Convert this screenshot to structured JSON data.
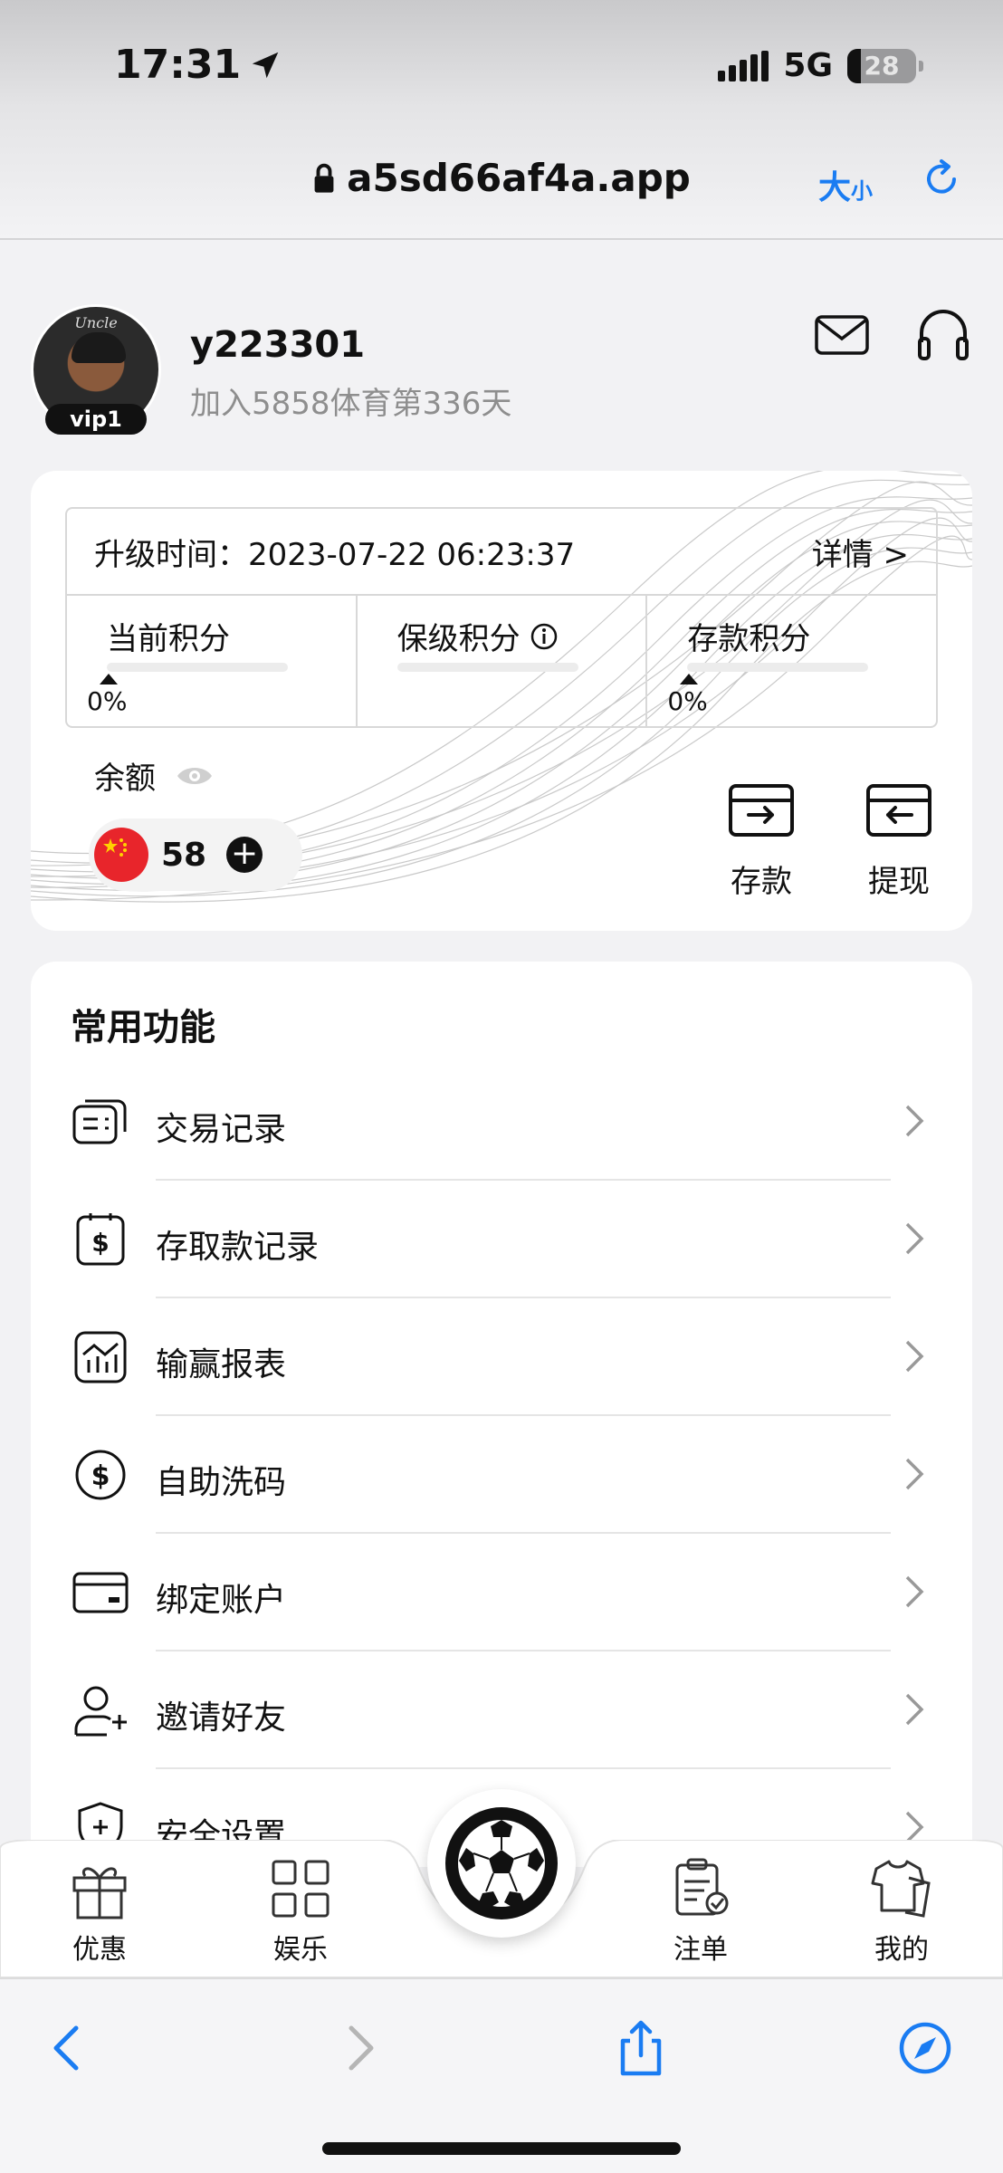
{
  "status_bar": {
    "time": "17:31",
    "network": "5G",
    "battery": "28"
  },
  "browser": {
    "url": "a5sd66af4a.app",
    "text_size_big": "大",
    "text_size_small": "小"
  },
  "profile": {
    "vip": "vip1",
    "username": "y223301",
    "joined": "加入5858体育第336天",
    "avatar_text": "Uncle"
  },
  "vip_card": {
    "upgrade_time": "升级时间：2023-07-22 06:23:37",
    "details": "详情 >",
    "columns": [
      {
        "title": "当前积分",
        "percent": "0%"
      },
      {
        "title": "保级积分",
        "percent": ""
      },
      {
        "title": "存款积分",
        "percent": "0%"
      }
    ],
    "balance_label": "余额",
    "balance_value": "58",
    "actions": {
      "deposit": "存款",
      "withdraw": "提现"
    }
  },
  "functions": {
    "title": "常用功能",
    "items": [
      {
        "label": "交易记录"
      },
      {
        "label": "存取款记录"
      },
      {
        "label": "输赢报表"
      },
      {
        "label": "自助洗码"
      },
      {
        "label": "绑定账户"
      },
      {
        "label": "邀请好友"
      },
      {
        "label": "安全设置"
      }
    ]
  },
  "tabbar": {
    "promo": "优惠",
    "entertainment": "娱乐",
    "bets": "注单",
    "mine": "我的"
  },
  "colors": {
    "accent": "#1a7cf2",
    "background": "#f2f2f4",
    "flag": "#e8252b"
  }
}
